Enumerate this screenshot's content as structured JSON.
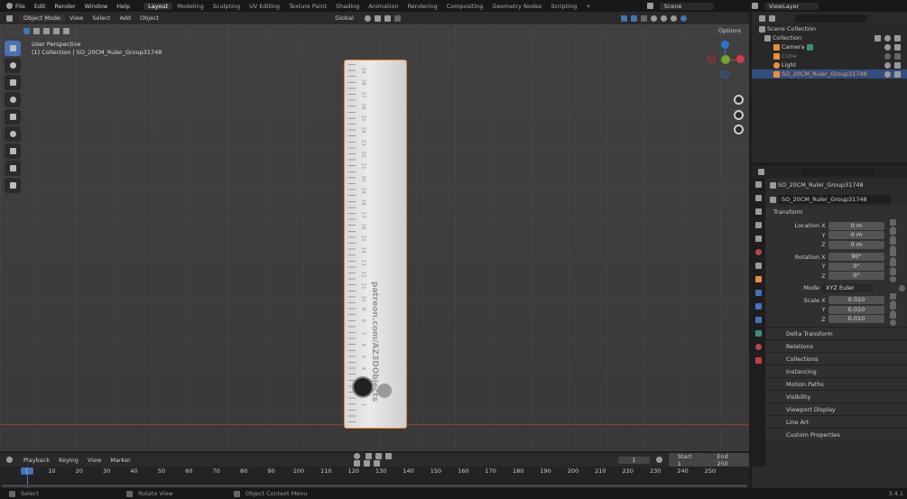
{
  "menu": {
    "items": [
      "File",
      "Edit",
      "Render",
      "Window",
      "Help"
    ],
    "workspaces": [
      "Layout",
      "Modeling",
      "Sculpting",
      "UV Editing",
      "Texture Paint",
      "Shading",
      "Animation",
      "Rendering",
      "Compositing",
      "Geometry Nodes",
      "Scripting",
      "+"
    ],
    "scene": "Scene",
    "view_layer": "ViewLayer"
  },
  "header": {
    "mode": "Object Mode",
    "menus": [
      "View",
      "Select",
      "Add",
      "Object"
    ],
    "orientation": "Global",
    "options": "Options"
  },
  "viewport": {
    "perspective": "User Perspective",
    "object_info": "(1) Collection | SO_20CM_Ruler_Group31748",
    "ruler_numbers": [
      "29",
      "28",
      "27",
      "26",
      "25",
      "24",
      "23",
      "22",
      "21",
      "20",
      "19",
      "18",
      "17",
      "16",
      "15",
      "14",
      "13",
      "12",
      "11",
      "10",
      "9",
      "8",
      "7",
      "6",
      "5",
      "4",
      "3",
      "2",
      "1"
    ],
    "ruler_text": "patreon.com/AZ3DObjects",
    "ruler_color": "#f08a24"
  },
  "outliner": {
    "root": "Scene Collection",
    "collection": "Collection",
    "items": [
      "Camera",
      "Cube",
      "Light",
      "SO_20CM_Ruler_Group31748"
    ]
  },
  "properties": {
    "object_name": "SO_20CM_Ruler_Group31748",
    "data_name": "SO_20CM_Ruler_Group31748",
    "transform": "Transform",
    "rows": [
      {
        "label": "Location X",
        "value": "0 m"
      },
      {
        "label": "Y",
        "value": "0 m"
      },
      {
        "label": "Z",
        "value": "0 m"
      },
      {
        "label": "Rotation X",
        "value": "90°"
      },
      {
        "label": "Y",
        "value": "0°"
      },
      {
        "label": "Z",
        "value": "0°"
      },
      {
        "label": "Mode",
        "value": "XYZ Euler"
      },
      {
        "label": "Scale X",
        "value": "0.010"
      },
      {
        "label": "Y",
        "value": "0.010"
      },
      {
        "label": "Z",
        "value": "0.010"
      }
    ],
    "sections": [
      "Delta Transform",
      "Relations",
      "Collections",
      "Instancing",
      "Motion Paths",
      "Visibility",
      "Viewport Display",
      "Line Art",
      "Custom Properties"
    ]
  },
  "timeline": {
    "menus": [
      "Playback",
      "Keying",
      "View",
      "Marker"
    ],
    "current_frame": "1",
    "start_label": "Start",
    "start": "1",
    "end_label": "End",
    "end": "250",
    "ticks": [
      "1",
      "10",
      "20",
      "30",
      "40",
      "50",
      "60",
      "70",
      "80",
      "90",
      "100",
      "110",
      "120",
      "130",
      "140",
      "150",
      "160",
      "170",
      "180",
      "190",
      "200",
      "210",
      "220",
      "230",
      "240",
      "250"
    ]
  },
  "status": {
    "items": [
      "Select",
      "Rotate View",
      "Object Context Menu"
    ],
    "version": "3.4.1"
  }
}
